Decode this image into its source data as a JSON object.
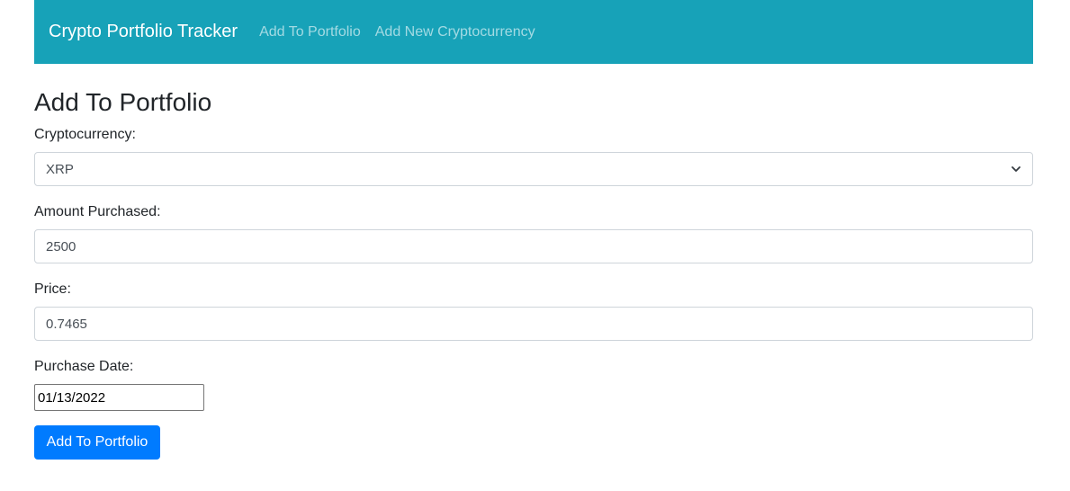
{
  "navbar": {
    "brand": "Crypto Portfolio Tracker",
    "links": [
      "Add To Portfolio",
      "Add New Cryptocurrency"
    ],
    "background": "#17a2b8"
  },
  "page": {
    "title": "Add To Portfolio"
  },
  "form": {
    "crypto_label": "Cryptocurrency:",
    "crypto_value": "XRP",
    "amount_label": "Amount Purchased:",
    "amount_value": "2500",
    "price_label": "Price:",
    "price_value": "0.7465",
    "date_label": "Purchase Date:",
    "date_value": "01/13/2022",
    "submit_label": "Add To Portfolio",
    "submit_color": "#007bff"
  }
}
